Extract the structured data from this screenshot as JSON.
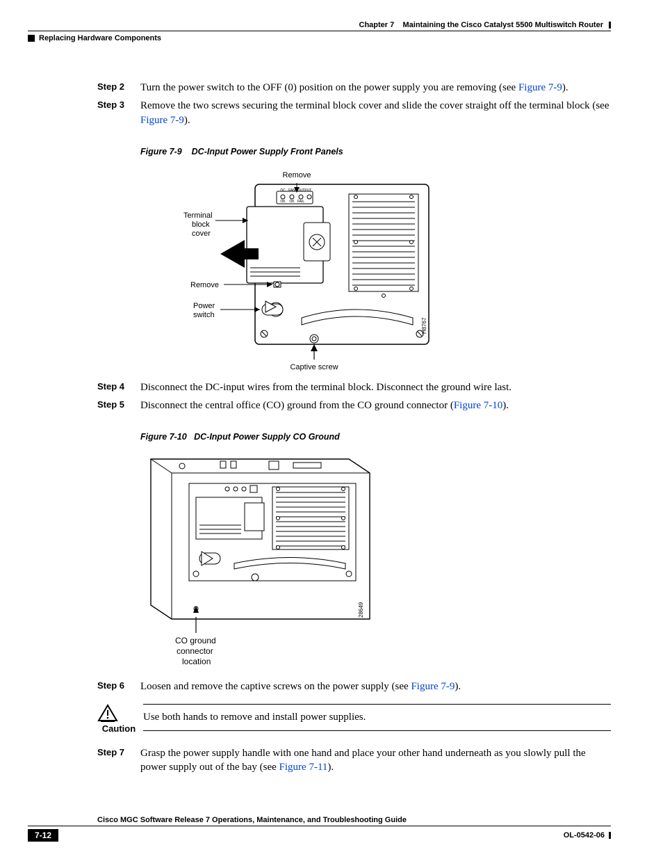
{
  "header": {
    "section": "Replacing Hardware Components",
    "chapter_prefix": "Chapter 7",
    "chapter_title": "Maintaining the Cisco Catalyst 5500 Multiswitch Router"
  },
  "steps": {
    "s2": {
      "label": "Step 2",
      "pre": "Turn the power switch to the OFF (0) position on the power supply you are removing (see ",
      "link": "Figure 7-9",
      "post": ")."
    },
    "s3": {
      "label": "Step 3",
      "pre": "Remove the two screws securing the terminal block cover and slide the cover straight off the terminal block (see ",
      "link": "Figure 7-9",
      "post": ")."
    },
    "s4": {
      "label": "Step 4",
      "text": "Disconnect the DC-input wires from the terminal block. Disconnect the ground wire last."
    },
    "s5": {
      "label": "Step 5",
      "pre": "Disconnect the central office (CO) ground from the CO ground connector (",
      "link": "Figure 7-10",
      "post": ")."
    },
    "s6": {
      "label": "Step 6",
      "pre": "Loosen and remove the captive screws on the power supply (see ",
      "link": "Figure 7-9",
      "post": ")."
    },
    "s7": {
      "label": "Step 7",
      "pre": "Grasp the power supply handle with one hand and place your other hand underneath as you slowly pull the power supply out of the bay (see ",
      "link": "Figure 7-11",
      "post": ")."
    }
  },
  "figures": {
    "f9": {
      "caption_num": "Figure 7-9",
      "caption_title": "DC-Input Power Supply Front Panels",
      "labels": {
        "remove_top": "Remove",
        "terminal1": "Terminal",
        "terminal2": "block",
        "terminal3": "cover",
        "remove_side": "Remove",
        "power1": "Power",
        "power2": "switch",
        "captive": "Captive screw",
        "leds": {
          "dc": "DC",
          "fan": "FAN",
          "out": "OUTPUT",
          "ok1": "OK",
          "ok2": "OK",
          "fail": "FAIL"
        },
        "id": "H8767"
      }
    },
    "f10": {
      "caption_num": "Figure 7-10",
      "caption_title": "DC-Input Power Supply CO Ground",
      "labels": {
        "co1": "CO ground",
        "co2": "connector",
        "co3": "location",
        "id": "28649"
      }
    }
  },
  "caution": {
    "label": "Caution",
    "text": "Use both hands to remove and install power supplies."
  },
  "footer": {
    "guide": "Cisco MGC Software Release 7 Operations, Maintenance, and Troubleshooting Guide",
    "page": "7-12",
    "doc_id": "OL-0542-06"
  }
}
